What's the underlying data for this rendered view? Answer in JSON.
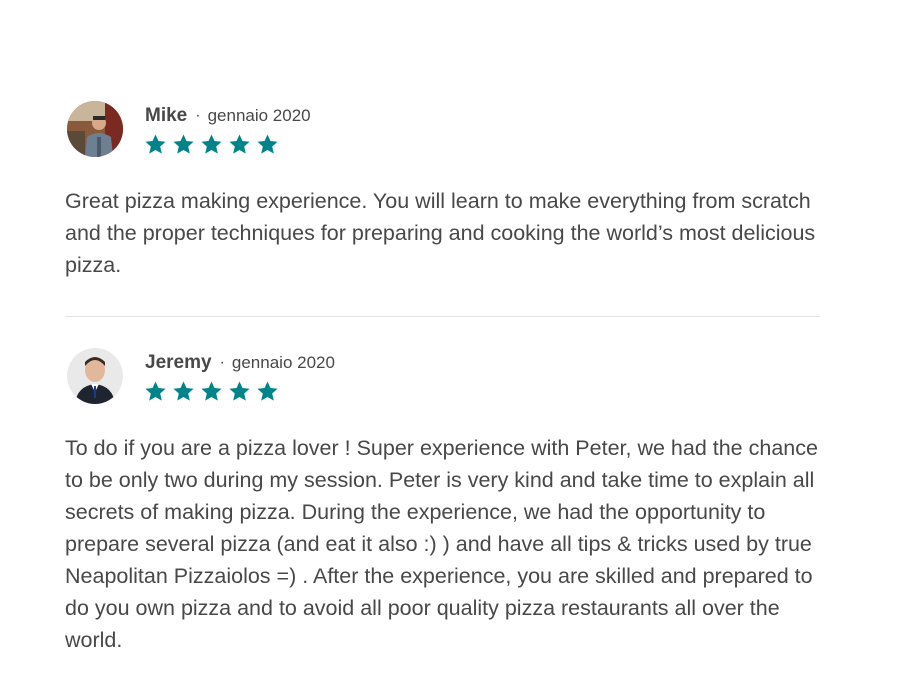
{
  "reviews": [
    {
      "name": "Mike",
      "separator": "·",
      "date": "gennaio 2020",
      "rating": 5,
      "avatar_icon": "user-photo-avatar",
      "text": "Great pizza making experience. You will learn to make everything from scratch and the proper techniques for preparing and cooking the world’s most delicious pizza."
    },
    {
      "name": "Jeremy",
      "separator": "·",
      "date": "gennaio 2020",
      "rating": 5,
      "avatar_icon": "user-photo-avatar",
      "text": "To do if you are a pizza lover ! Super experience with Peter, we had the chance to be only two during my session. Peter is very kind and take time to explain all secrets of making pizza. During the experience, we had the opportunity to prepare several pizza (and eat it also :) ) and have all tips & tricks used by true Neapolitan Pizzaiolos =) . After the experience, you are skilled and prepared to do you own pizza and to avoid all poor quality pizza restaurants all over the world."
    }
  ],
  "colors": {
    "star": "#008489",
    "text": "#484848",
    "divider": "#e4e4e4"
  },
  "icons": {
    "star": "star-icon"
  }
}
